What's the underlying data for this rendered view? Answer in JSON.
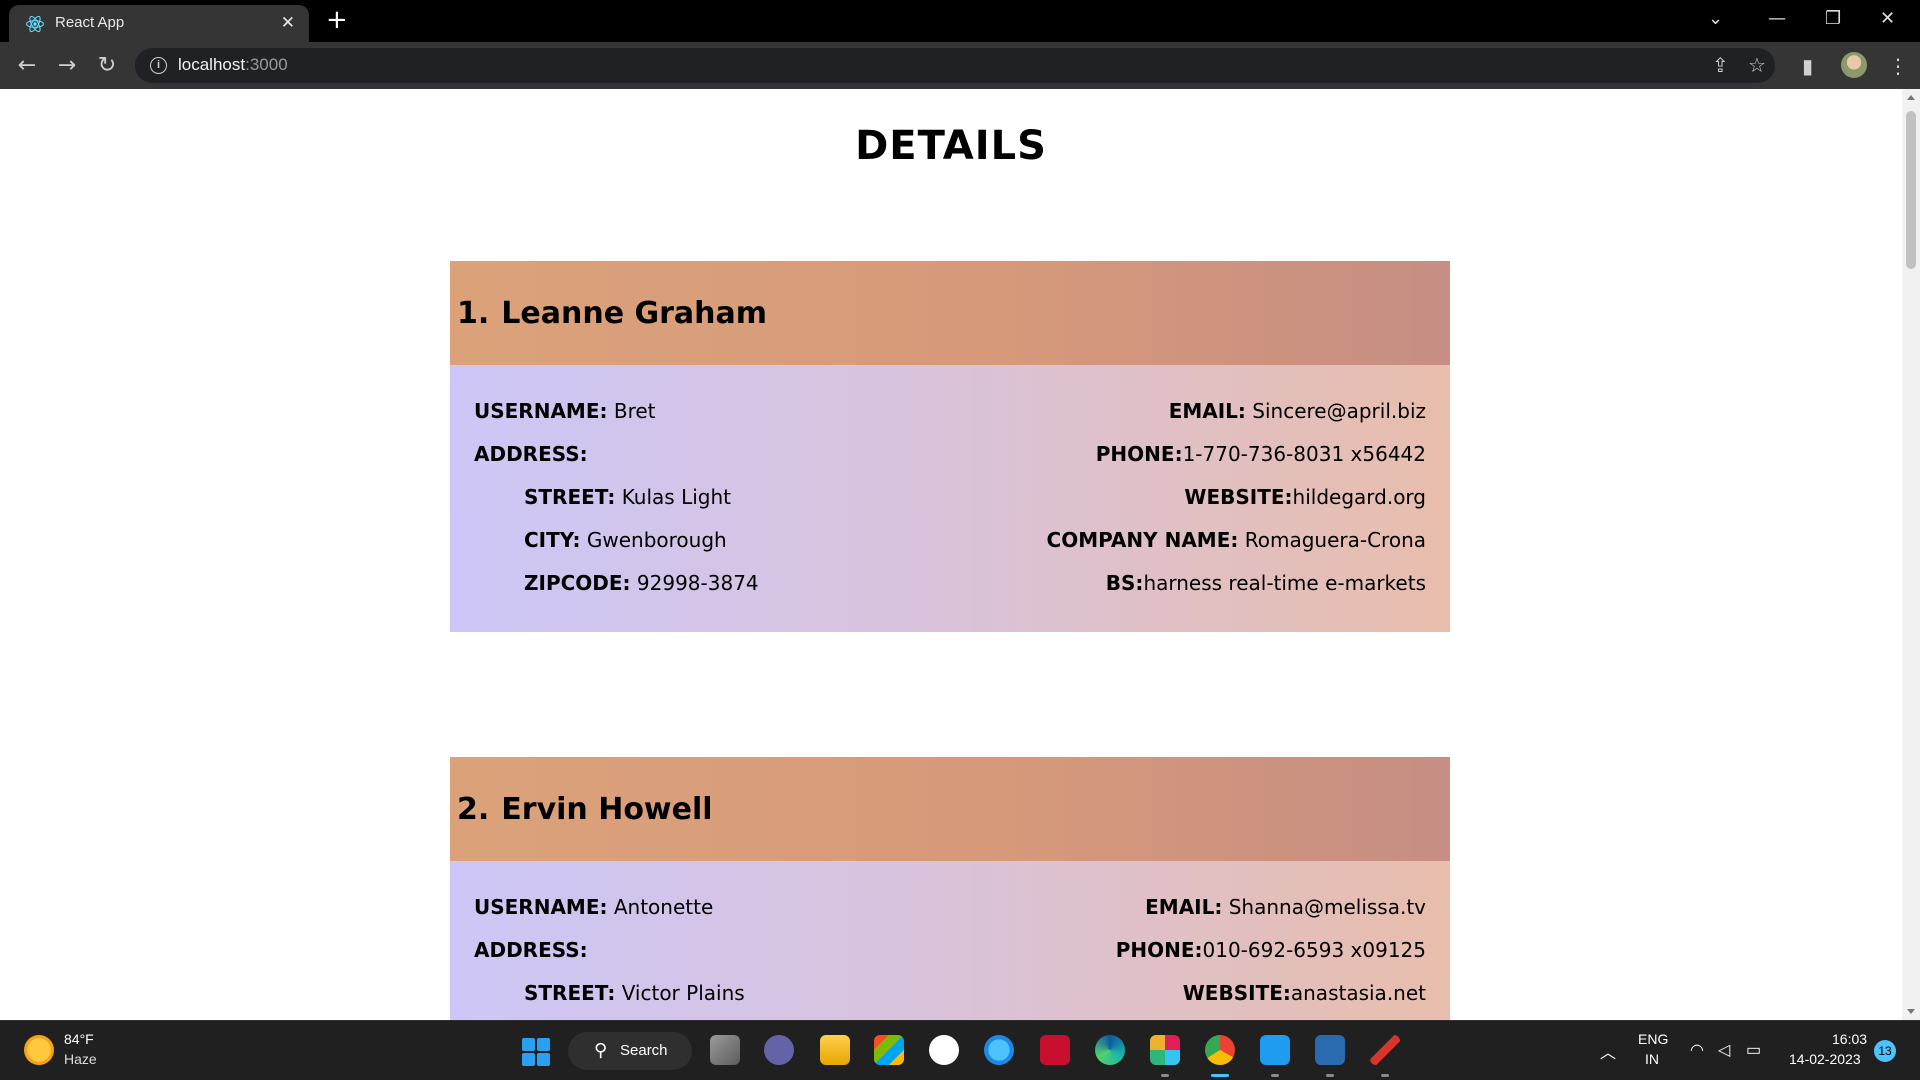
{
  "browser": {
    "tab_title": "React App",
    "tab_close": "✕",
    "new_tab": "+",
    "url_host": "localhost",
    "url_port": ":3000"
  },
  "page": {
    "title": "DETAILS",
    "users": [
      {
        "num": "1.",
        "name": "Leanne Graham",
        "username_label": "USERNAME:",
        "username": "Bret",
        "address_label": "ADDRESS:",
        "street_label": "STREET:",
        "street": "Kulas Light",
        "city_label": "CITY:",
        "city": "Gwenborough",
        "zipcode_label": "ZIPCODE:",
        "zipcode": "92998-3874",
        "email_label": "EMAIL:",
        "email": "Sincere@april.biz",
        "phone_label": "PHONE:",
        "phone": "1-770-736-8031 x56442",
        "website_label": "WEBSITE:",
        "website": "hildegard.org",
        "company_label": "COMPANY NAME:",
        "company": "Romaguera-Crona",
        "bs_label": "BS:",
        "bs": "harness real-time e-markets"
      },
      {
        "num": "2.",
        "name": "Ervin Howell",
        "username_label": "USERNAME:",
        "username": "Antonette",
        "address_label": "ADDRESS:",
        "street_label": "STREET:",
        "street": "Victor Plains",
        "email_label": "EMAIL:",
        "email": "Shanna@melissa.tv",
        "phone_label": "PHONE:",
        "phone": "010-692-6593 x09125",
        "website_label": "WEBSITE:",
        "website": "anastasia.net"
      }
    ]
  },
  "taskbar": {
    "weather_temp": "84°F",
    "weather_cond": "Haze",
    "search_label": "Search",
    "lang_top": "ENG",
    "lang_bottom": "IN",
    "time": "16:03",
    "date": "14-02-2023",
    "notification_count": "13"
  },
  "colors": {
    "card_header_start": "#dba27a",
    "card_header_end": "#c68e84",
    "card_body_start": "#cdc6f6",
    "card_body_end": "#e8bdac",
    "taskbar_bg": "#202020",
    "accent": "#4cc2ff"
  }
}
